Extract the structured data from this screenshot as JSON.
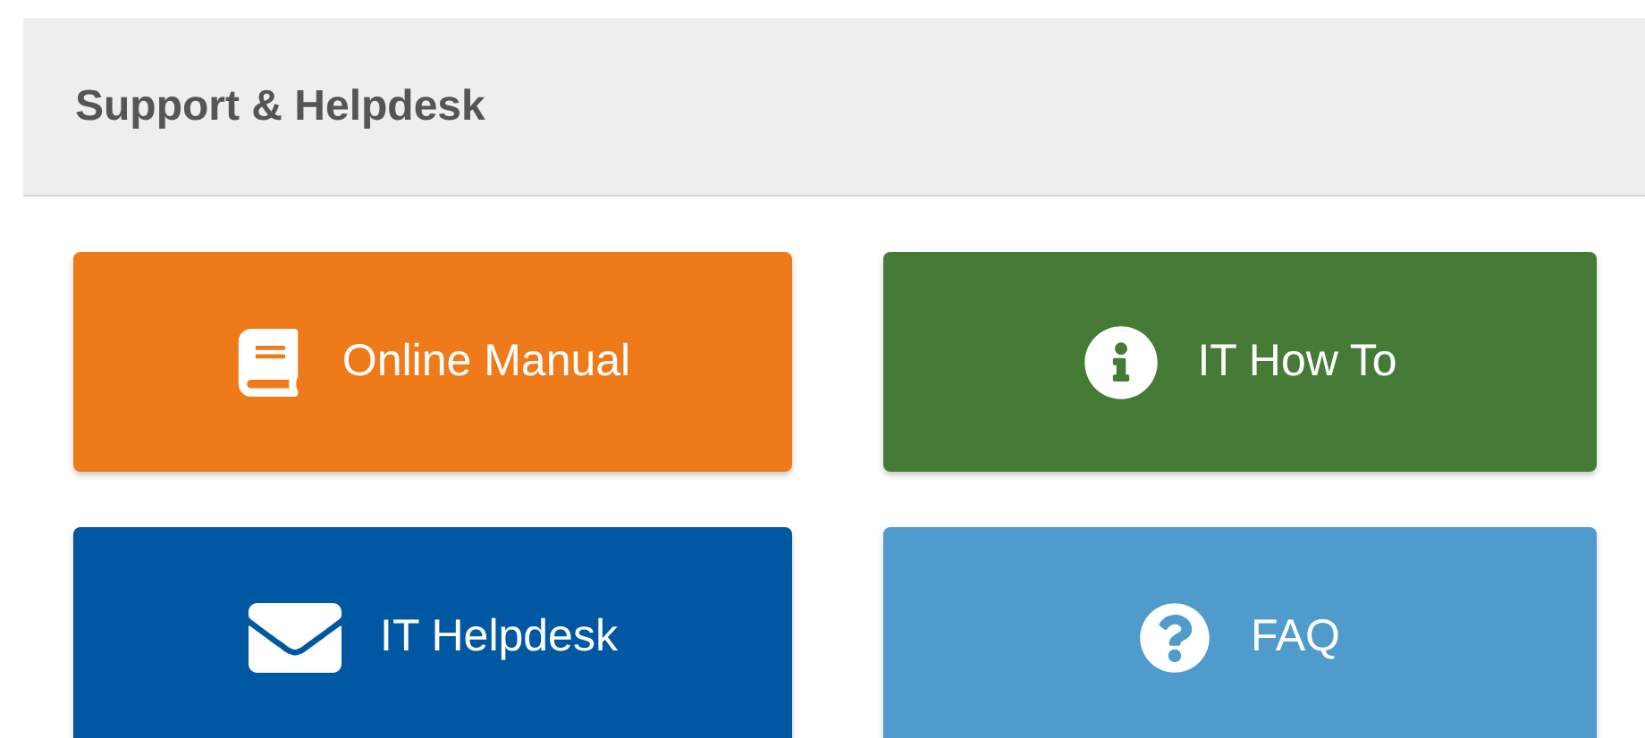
{
  "header": {
    "title": "Support & Helpdesk"
  },
  "buttons": [
    {
      "label": "Online Manual",
      "kind": "book",
      "color": "#ee7a1a"
    },
    {
      "label": "IT How To",
      "kind": "info",
      "color": "#467a37"
    },
    {
      "label": "IT Helpdesk",
      "kind": "envelope",
      "color": "#0058a3"
    },
    {
      "label": "FAQ",
      "kind": "question",
      "color": "#4f9bcb"
    }
  ]
}
